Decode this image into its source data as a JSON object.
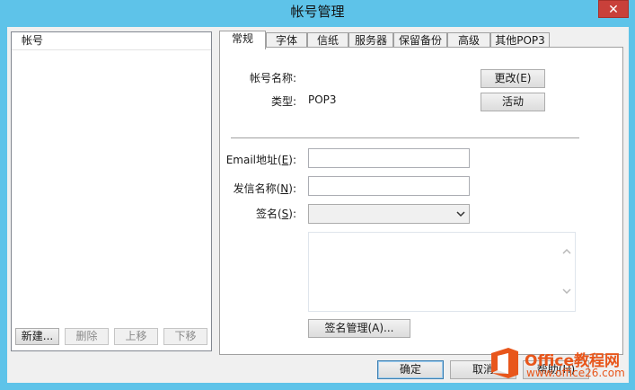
{
  "window": {
    "title": "帐号管理",
    "close_glyph": "✕"
  },
  "accounts": {
    "header": "帐号",
    "items": [],
    "buttons": {
      "new": "新建...",
      "delete": "删除",
      "move_up": "上移",
      "move_down": "下移"
    }
  },
  "tabs": [
    "常规",
    "字体",
    "信纸",
    "服务器",
    "保留备份",
    "高级",
    "其他POP3"
  ],
  "general": {
    "account_name_label": "帐号名称:",
    "account_name_value": "",
    "type_label": "类型:",
    "type_value": "POP3",
    "change_button": "更改(E)",
    "activate_button": "活动",
    "email_label": "Email地址(",
    "email_key": "E",
    "email_value": "",
    "sender_label": "发信名称(",
    "sender_key": "N",
    "sender_value": "",
    "signature_label": "签名(",
    "signature_key": "S",
    "signature_selected": "",
    "signature_manage_button": "签名管理(A)..."
  },
  "footer": {
    "ok": "确定",
    "cancel": "取消",
    "help": "帮助(H)"
  },
  "watermark": {
    "brand": "Office教程网",
    "url": "www.office26.com"
  },
  "icons": {
    "close": "close-icon",
    "dropdown": "chevron-down-icon",
    "scroll_up": "scroll-up-icon",
    "scroll_down": "scroll-down-icon",
    "logo": "office-logo-icon"
  },
  "colors": {
    "title_bar": "#5ec3e9",
    "close_button": "#c9403a",
    "watermark": "#e8561b"
  }
}
